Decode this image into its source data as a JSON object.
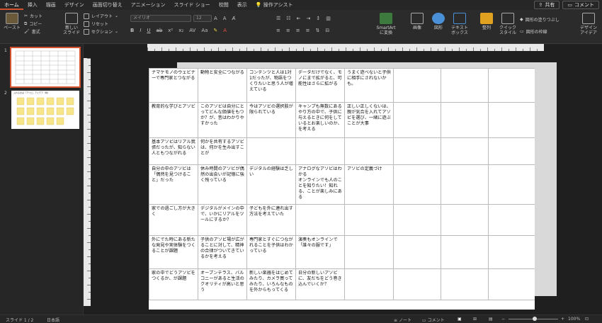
{
  "tabs": [
    "ホーム",
    "挿入",
    "描画",
    "デザイン",
    "画面切り替え",
    "アニメーション",
    "スライド ショー",
    "校閲",
    "表示",
    "操作アシスト"
  ],
  "tab_active": "ホーム",
  "share_label": "共有",
  "comment_label": "コメント",
  "ribbon": {
    "paste": "ペースト",
    "cut": "カット",
    "copy": "コピー",
    "format": "書式",
    "new_slide": "新しい\nスライド",
    "layout": "レイアウト",
    "reset": "リセット",
    "section": "セクション",
    "font_name": "メイリオ",
    "font_size": "12",
    "smartart": "SmartArt\nに変換",
    "picture": "画像",
    "shapes": "図形",
    "textbox": "テキスト\nボックス",
    "arrange": "整列",
    "quick_styles": "クイック\nスタイル",
    "shape_fill": "図形の塗りつぶし",
    "shape_outline": "図形の枠線",
    "design_ideas": "デザイン\nアイデア"
  },
  "thumbnails": {
    "slide1_num": "1",
    "slide2_num": "2",
    "slide2_title": "入れるのは「アソビ」アイデア（例）"
  },
  "table": {
    "rows": [
      [
        "ナマケモノのウェビナーで専門家とつながる",
        "動物と安全につながる",
        "コンテンツと人は1対1だったが、物語をつくりたいと思う人が増えている",
        "データだけでなく、モノにまで拡がると、可能性はさらに拡がる",
        "うまく遊べないと子供に相手にされないかも。",
        "",
        "",
        ""
      ],
      [
        "教育的な学びとアソビ",
        "このアソビは自分にとってどんな価値をもつか？が、昔はわかりやすかった",
        "今はアソビの選択肢が限られている",
        "キャンプも無数にあるやり方の中で、子供に与えるときに何をしているとお楽しいのか、を考える",
        "正しい正しくないは、親が気合を入れてアソビを選び、一緒に遊ぶことが大事",
        "",
        "",
        ""
      ],
      [
        "基本アソビはリアル我張だったが、知らない人ともつながれる",
        "何かを共有するアソビは、何かを生み出すことが",
        "",
        "",
        "",
        "",
        "",
        ""
      ],
      [
        "自分の中のアソビは「偶然を見つけること」だった",
        "休み時間のアソビが偶然の出会いが記憶に強く残っている",
        "デジタルの経験は乏しい",
        "アナログなアソビはわかる\nオンラインでも人のことを知りたい！知れる、ことが楽しみにある",
        "アソビの定義づけ",
        "",
        "",
        ""
      ],
      [
        "家での過ごし方が大きく",
        "デジタルがメインの中で、いかにリアルをツールにするか？",
        "子どもを外に連れ出す方法を考えていた",
        "",
        "",
        "",
        "",
        ""
      ],
      [
        "外にでた時にある新たな発見や実体験をつくることが課題",
        "子供のアソビ場が広がることに対して、精神の合律がついてきているかを考える",
        "専門家とすぐにつながれることを子供はわかっている",
        "演奏もオンラインで「誰々の服です」",
        "",
        "",
        "",
        ""
      ],
      [
        "家の中でどうアソビをつくるか、が課題",
        "オープンテラス、バルコニーがあると生活のクオリティが高いと思う",
        "新しい楽器をはじめてみたり、カメラ買ってみたり、いろんなものを外からもってくる",
        "日分の新しいアソビに、友だちをどう巻き込んでいくか？",
        "",
        "",
        "",
        ""
      ]
    ]
  },
  "status": {
    "slide_info": "スライド 1 / 2",
    "language": "日本語",
    "notes": "ノート",
    "comments": "コメント",
    "zoom": "100%"
  },
  "accent": "#d35230"
}
